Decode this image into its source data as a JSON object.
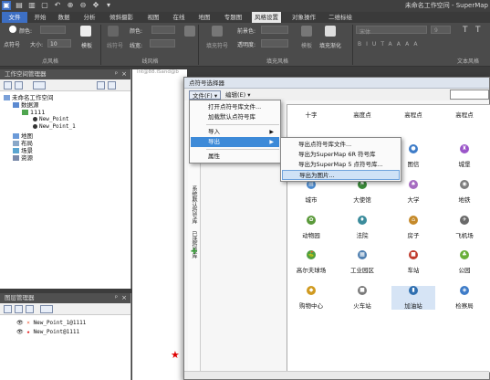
{
  "app": {
    "title": "未命名工作空间 - SuperMap"
  },
  "tabs": [
    "文件",
    "开始",
    "数据",
    "分析",
    "倾斜摄影",
    "视图",
    "在线",
    "地图",
    "专题图",
    "风格设置",
    "对象操作",
    "二维标绘"
  ],
  "ribbon": {
    "point_group": "点风格",
    "line_group": "线风格",
    "fill_group": "填充风格",
    "text_group": "文本风格",
    "color_label": "颜色:",
    "symbol_label": "点符号",
    "size_label": "大小:",
    "size_value": "10",
    "template_label": "模板",
    "line_symbol_label": "线符号",
    "line_width_label": "线宽:",
    "fill_symbol_label": "填充符号",
    "fore_color_label": "前景色:",
    "opacity_label": "透明度:",
    "fill_template_label": "模板",
    "gradient_label": "填充渐化",
    "font_box": "宋体",
    "font_size_box": "9",
    "fmt_buttons": [
      "B",
      "I",
      "U",
      "T",
      "A",
      "A",
      "A",
      "A"
    ],
    "right_t1": "T",
    "right_t2": "T"
  },
  "workspace_panel": {
    "title": "工作空间管理器",
    "tree": [
      {
        "label": "未命名工作空间",
        "indent": 0
      },
      {
        "label": "数据源",
        "indent": 1
      },
      {
        "label": "1111",
        "indent": 2
      },
      {
        "label": "New_Point",
        "indent": 3
      },
      {
        "label": "New_Point_1",
        "indent": 3
      },
      {
        "label": "地图",
        "indent": 1
      },
      {
        "label": "布局",
        "indent": 1
      },
      {
        "label": "场景",
        "indent": 1
      },
      {
        "label": "资源",
        "indent": 1
      }
    ]
  },
  "layer_panel": {
    "title": "图层管理器",
    "layers": [
      "New_Point_1@1111",
      "New_Point@1111"
    ]
  },
  "map": {
    "tab_label": "int@88.ISand@b"
  },
  "dialog": {
    "title": "点符号选择器",
    "menus": [
      "文件(F) ▾",
      "编辑(E) ▾"
    ],
    "left_tabs": [
      "系统默认符号库",
      "已选符号库"
    ],
    "cells": [
      {
        "label": "十字",
        "color": "#ffffff",
        "glyph": ""
      },
      {
        "label": "高度点",
        "color": "#ffffff",
        "glyph": ""
      },
      {
        "label": "高程点",
        "color": "#ffffff",
        "glyph": ""
      },
      {
        "label": "高程点",
        "color": "#ffffff",
        "glyph": ""
      },
      {
        "label": "",
        "color": "#ffffff",
        "glyph": ""
      },
      {
        "label": "",
        "color": "#ffffff",
        "glyph": ""
      },
      {
        "label": "图信",
        "color": "#3e7cc8",
        "glyph": "●"
      },
      {
        "label": "城堡",
        "color": "#9b56c9",
        "glyph": "♜"
      },
      {
        "label": "城市",
        "color": "#4b8bd0",
        "glyph": "▤"
      },
      {
        "label": "大使馆",
        "color": "#3b8a3b",
        "glyph": "⚑"
      },
      {
        "label": "大学",
        "color": "#a66cc1",
        "glyph": "♠"
      },
      {
        "label": "地铁",
        "color": "#7d7d7d",
        "glyph": "◉"
      },
      {
        "label": "动物园",
        "color": "#5b9a3b",
        "glyph": "✿"
      },
      {
        "label": "法院",
        "color": "#3c8c9c",
        "glyph": "♦"
      },
      {
        "label": "房子",
        "color": "#c58a2a",
        "glyph": "⌂"
      },
      {
        "label": "飞机场",
        "color": "#6a6a6a",
        "glyph": "✈"
      },
      {
        "label": "高尔夫球场",
        "color": "#4f9f40",
        "glyph": "⛳"
      },
      {
        "label": "工业园区",
        "color": "#4f7fb0",
        "glyph": "▦"
      },
      {
        "label": "车站",
        "color": "#c0392b",
        "glyph": "■"
      },
      {
        "label": "公园",
        "color": "#6aaf3a",
        "glyph": "♣"
      },
      {
        "label": "购物中心",
        "color": "#d09a20",
        "glyph": "◆"
      },
      {
        "label": "火车站",
        "color": "#7a7a7a",
        "glyph": "■"
      },
      {
        "label": "加油站",
        "color": "#2f6fb0",
        "glyph": "▮"
      },
      {
        "label": "检察局",
        "color": "#3e7cc8",
        "glyph": "◈"
      }
    ]
  },
  "file_menu": {
    "items": [
      {
        "label": "打开点符号库文件...",
        "submenu": false,
        "highlight": false
      },
      {
        "label": "加载默认点符号库",
        "submenu": false,
        "highlight": false
      },
      {
        "label": "导入",
        "submenu": true,
        "highlight": false
      },
      {
        "label": "导出",
        "submenu": true,
        "highlight": true
      },
      {
        "label": "属性",
        "submenu": false,
        "highlight": false
      }
    ]
  },
  "export_menu": {
    "items": [
      {
        "label": "导出点符号库文件...",
        "highlight": false
      },
      {
        "label": "导出为SuperMap 6R 符号库",
        "highlight": false
      },
      {
        "label": "导出为SuperMap 5 点符号库...",
        "highlight": false
      },
      {
        "label": "导出为图片...",
        "highlight": true
      }
    ]
  },
  "colors": {
    "file_tab": "#3d6fc4",
    "menu_highlight": "#3d8ad8",
    "star": "#e00000"
  }
}
